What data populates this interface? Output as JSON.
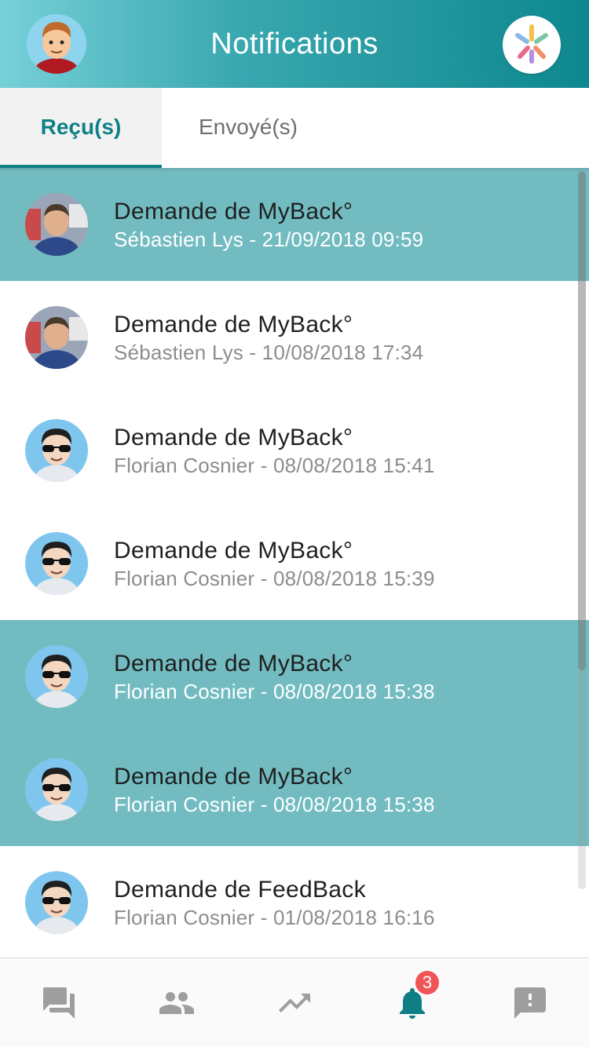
{
  "header": {
    "title": "Notifications",
    "accent_color": "#0d878e"
  },
  "tabs": [
    {
      "label": "Reçu(s)",
      "active": true
    },
    {
      "label": "Envoyé(s)",
      "active": false
    }
  ],
  "notifications": [
    {
      "title": "Demande de MyBack°",
      "subtitle": "Sébastien Lys - 21/09/2018 09:59",
      "unread": true,
      "avatar": "photo-avatar"
    },
    {
      "title": "Demande de MyBack°",
      "subtitle": "Sébastien Lys - 10/08/2018 17:34",
      "unread": false,
      "avatar": "photo-avatar"
    },
    {
      "title": "Demande de MyBack°",
      "subtitle": "Florian Cosnier - 08/08/2018 15:41",
      "unread": false,
      "avatar": "cartoon-sunglasses-avatar"
    },
    {
      "title": "Demande de MyBack°",
      "subtitle": "Florian Cosnier - 08/08/2018 15:39",
      "unread": false,
      "avatar": "cartoon-sunglasses-avatar"
    },
    {
      "title": "Demande de MyBack°",
      "subtitle": "Florian Cosnier - 08/08/2018 15:38",
      "unread": true,
      "avatar": "cartoon-sunglasses-avatar"
    },
    {
      "title": "Demande de MyBack°",
      "subtitle": "Florian Cosnier - 08/08/2018 15:38",
      "unread": true,
      "avatar": "cartoon-sunglasses-avatar"
    },
    {
      "title": "Demande de FeedBack",
      "subtitle": "Florian Cosnier - 01/08/2018 16:16",
      "unread": false,
      "avatar": "cartoon-sunglasses-avatar"
    }
  ],
  "bottom_nav": {
    "items": [
      {
        "icon": "chat-icon",
        "active": false
      },
      {
        "icon": "people-icon",
        "active": false
      },
      {
        "icon": "trending-icon",
        "active": false
      },
      {
        "icon": "bell-icon",
        "active": true,
        "badge": "3"
      },
      {
        "icon": "feedback-icon",
        "active": false
      }
    ]
  },
  "colors": {
    "unread_row": "#72bcc1",
    "active_tab": "#0f7f86",
    "badge": "#f05454",
    "nav_inactive": "#9e9e9e"
  }
}
